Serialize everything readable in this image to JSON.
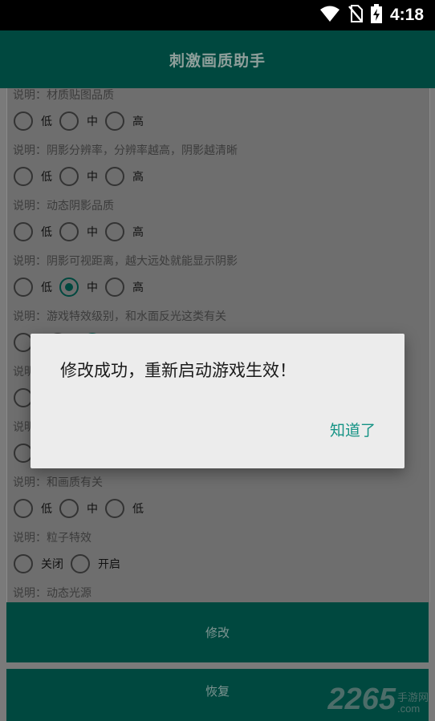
{
  "status_bar": {
    "time": "4:18",
    "icons": [
      "wifi-icon",
      "no-sim-icon",
      "battery-charging-icon"
    ]
  },
  "app_bar": {
    "title": "刺激画质助手"
  },
  "settings": [
    {
      "description": "说明：材质贴图品质",
      "options": [
        "低",
        "中",
        "高"
      ],
      "selected": null
    },
    {
      "description": "说明：阴影分辨率，分辨率越高，阴影越清晰",
      "options": [
        "低",
        "中",
        "高"
      ],
      "selected": null
    },
    {
      "description": "说明：动态阴影品质",
      "options": [
        "低",
        "中",
        "高"
      ],
      "selected": null
    },
    {
      "description": "说明：阴影可视距离，越大远处就能显示阴影",
      "options": [
        "低",
        "中",
        "高"
      ],
      "selected": 1
    },
    {
      "description": "说明：游戏特效级别，和水面反光这类有关",
      "options": [
        "",
        "",
        ""
      ],
      "selected": 2
    },
    {
      "description": "说明",
      "options": [
        ""
      ],
      "selected": null
    },
    {
      "description": "说明",
      "options": [
        ""
      ],
      "selected": null
    },
    {
      "description": "说明：和画质有关",
      "options": [
        "低",
        "中",
        "低"
      ],
      "selected": null
    },
    {
      "description": "说明：粒子特效",
      "options": [
        "关闭",
        "开启"
      ],
      "selected": null
    },
    {
      "description": "说明：动态光源",
      "options": [],
      "selected": null
    }
  ],
  "buttons": {
    "modify": "修改",
    "restore": "恢复"
  },
  "watermark": {
    "number": "2265",
    "top": "手游网",
    "bottom": ".com"
  },
  "dialog": {
    "message": "修改成功，重新启动游戏生效！",
    "confirm": "知道了"
  }
}
